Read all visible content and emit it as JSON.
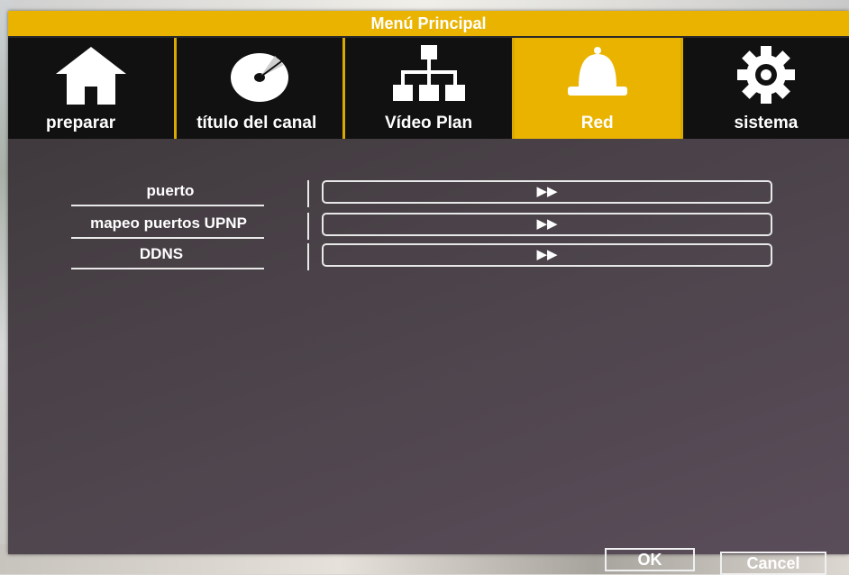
{
  "window": {
    "title": "Menú Principal"
  },
  "tabs": [
    {
      "label": "preparar",
      "icon": "home-icon",
      "active": false
    },
    {
      "label": "título del canal",
      "icon": "disc-icon",
      "active": false
    },
    {
      "label": "Vídeo Plan",
      "icon": "network-icon",
      "active": false
    },
    {
      "label": "Red",
      "icon": "bell-icon",
      "active": true
    },
    {
      "label": "sistema",
      "icon": "gear-icon",
      "active": false
    }
  ],
  "settings": [
    {
      "label": "puerto",
      "button": "▶▶"
    },
    {
      "label": "mapeo puertos UPNP",
      "button": "▶▶"
    },
    {
      "label": "DDNS",
      "button": "▶▶"
    }
  ],
  "footer": {
    "ok_label": "OK",
    "cancel_label": "Cancel"
  },
  "colors": {
    "accent": "#e9b300",
    "panel": "#433c42",
    "tab_bg": "#111111",
    "text": "#ffffff"
  }
}
